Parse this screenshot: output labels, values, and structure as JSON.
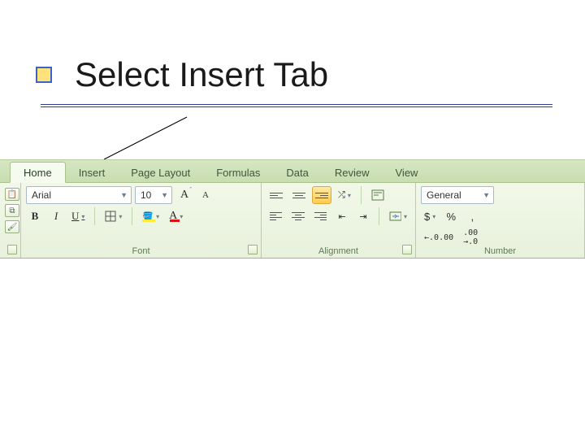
{
  "slide": {
    "title": "Select Insert Tab"
  },
  "ribbon": {
    "tabs": [
      "Home",
      "Insert",
      "Page Layout",
      "Formulas",
      "Data",
      "Review",
      "View"
    ],
    "activeTab": "Home"
  },
  "font": {
    "name": "Arial",
    "size": "10",
    "buttons": {
      "bold": "B",
      "italic": "I",
      "underline": "U",
      "increaseA": "A",
      "decreaseA": "A",
      "fontColorA": "A"
    },
    "groupLabel": "Font"
  },
  "alignment": {
    "groupLabel": "Alignment"
  },
  "number": {
    "format": "General",
    "currency": "$",
    "percent": "%",
    "comma": ",",
    "incDec": ".00",
    "decDec": ".00",
    "groupLabel": "Number"
  }
}
